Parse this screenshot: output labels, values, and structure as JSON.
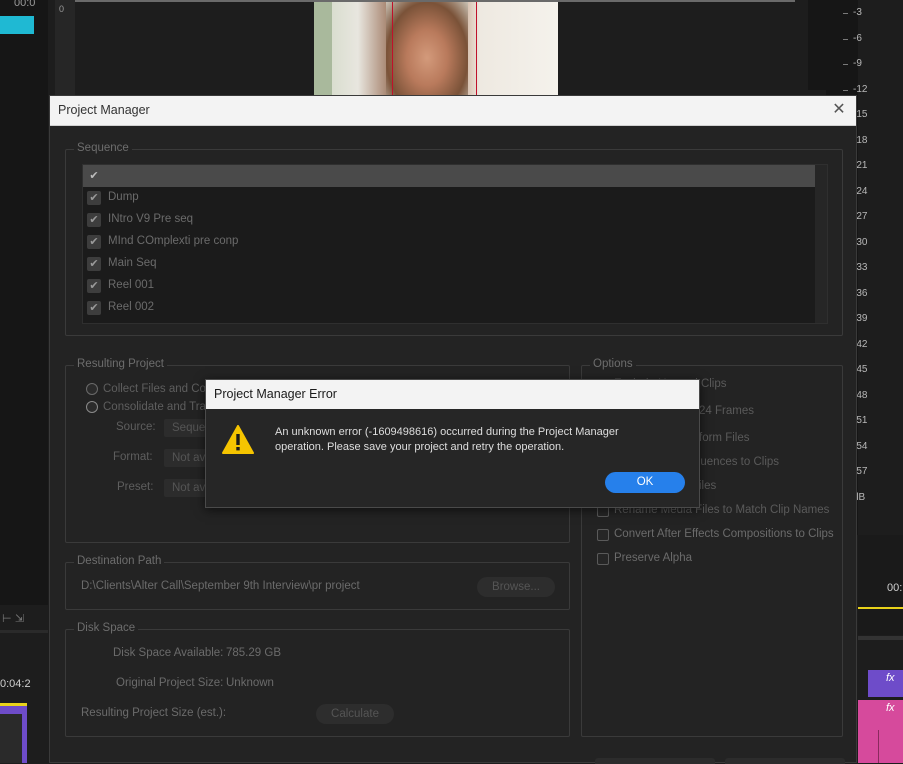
{
  "background_app": {
    "timecode_top_left": "00:0",
    "timecode_mid_left": "0:04:2",
    "timecode_right": "00:",
    "ruler_zero": "0",
    "meter_ticks": [
      "-3",
      "-6",
      "-9",
      "-12",
      "-15",
      "-18",
      "-21",
      "-24",
      "-27",
      "-30",
      "-33",
      "-36",
      "-39",
      "-42",
      "-45",
      "-48",
      "-51",
      "-54",
      "-57",
      "dB"
    ],
    "fx_badge": "fx",
    "accent_cyan": "#1fb9d3",
    "accent_purple": "#6e4cc9",
    "accent_pink": "#d64a9c",
    "playhead_yellow": "#e8d21a"
  },
  "project_manager": {
    "title": "Project Manager",
    "sequence_group": {
      "label": "Sequence",
      "items": [
        {
          "name": "Dump"
        },
        {
          "name": "INtro V9 Pre seq"
        },
        {
          "name": "MInd COmplexti pre conp"
        },
        {
          "name": "Main Seq"
        },
        {
          "name": "Reel 001"
        },
        {
          "name": "Reel 002"
        }
      ]
    },
    "resulting_project": {
      "label": "Resulting Project",
      "collect_option": "Collect Files and Cop",
      "consolidate_option": "Consolidate and Tra",
      "source_label": "Source:",
      "source_value": "Seque",
      "format_label": "Format:",
      "format_value": "Not av",
      "preset_label": "Preset:",
      "preset_value": "Not av"
    },
    "options": {
      "label": "Options",
      "items": [
        "Exclude Unused Clips",
        "24 Frames",
        "form Files",
        "quences to Clips",
        "iles",
        "Rename Media Files to Match Clip Names",
        "Convert After Effects Compositions to Clips",
        "Preserve Alpha"
      ]
    },
    "destination_path": {
      "label": "Destination Path",
      "path": "D:\\Clients\\Alter Call\\September 9th Interview\\pr project",
      "browse_label": "Browse..."
    },
    "disk_space": {
      "label": "Disk Space",
      "available_label": "Disk Space Available:",
      "available_value": "785.29 GB",
      "original_label": "Original Project Size:",
      "original_value": "Unknown",
      "resulting_label": "Resulting Project Size (est.):",
      "calculate_label": "Calculate"
    }
  },
  "error_dialog": {
    "title": "Project Manager Error",
    "message_line1": "An unknown error (-1609498616) occurred during the Project Manager",
    "message_line2": "operation. Please save your project and retry the operation.",
    "ok_label": "OK",
    "icon": "warning-icon",
    "icon_color": "#f5c400"
  }
}
